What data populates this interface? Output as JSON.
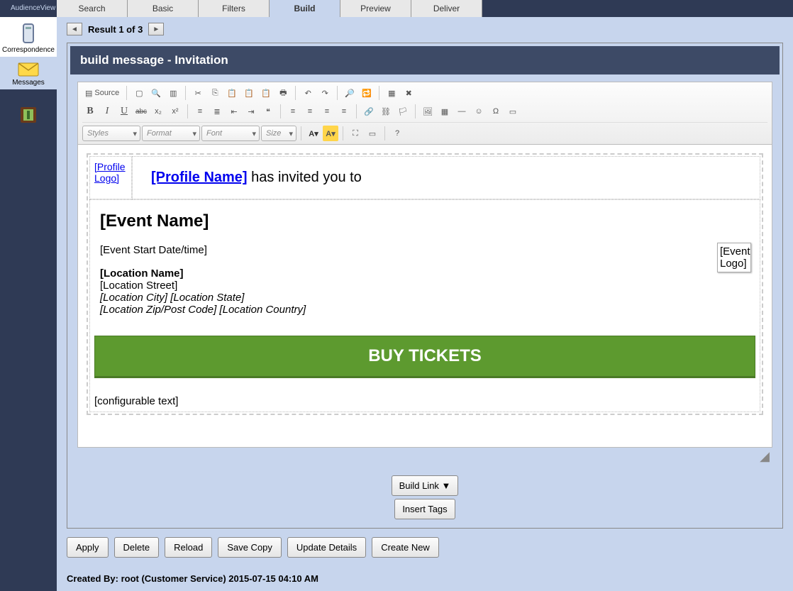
{
  "app": {
    "name": "AudienceView"
  },
  "tabs": [
    "Search",
    "Basic",
    "Filters",
    "Build",
    "Preview",
    "Deliver"
  ],
  "active_tab": "Build",
  "sidebar": {
    "correspondence": "Correspondence",
    "messages": "Messages"
  },
  "result": {
    "text": "Result 1 of 3"
  },
  "panel": {
    "title": "build message - Invitation"
  },
  "toolbar": {
    "source": "Source",
    "styles": "Styles",
    "format": "Format",
    "font": "Font",
    "size": "Size"
  },
  "email": {
    "profile_logo": "[Profile Logo]",
    "profile_name": "[Profile Name]",
    "invited_suffix": " has invited you to",
    "event_name": "[Event Name]",
    "event_start": "[Event Start Date/time]",
    "event_logo": "[Event Logo]",
    "location_name": "[Location Name]",
    "location_street": "[Location Street]",
    "location_city_state": "[Location City] [Location State]",
    "location_zip_country": "[Location Zip/Post Code] [Location Country]",
    "buy": "BUY TICKETS",
    "config": "[configurable text]"
  },
  "below": {
    "build_link": "Build Link ▼",
    "insert_tags": "Insert Tags"
  },
  "actions": {
    "apply": "Apply",
    "delete": "Delete",
    "reload": "Reload",
    "save_copy": "Save Copy",
    "update_details": "Update Details",
    "create_new": "Create New"
  },
  "footer": {
    "created": "Created By: root (Customer Service) 2015-07-15 04:10 AM"
  }
}
